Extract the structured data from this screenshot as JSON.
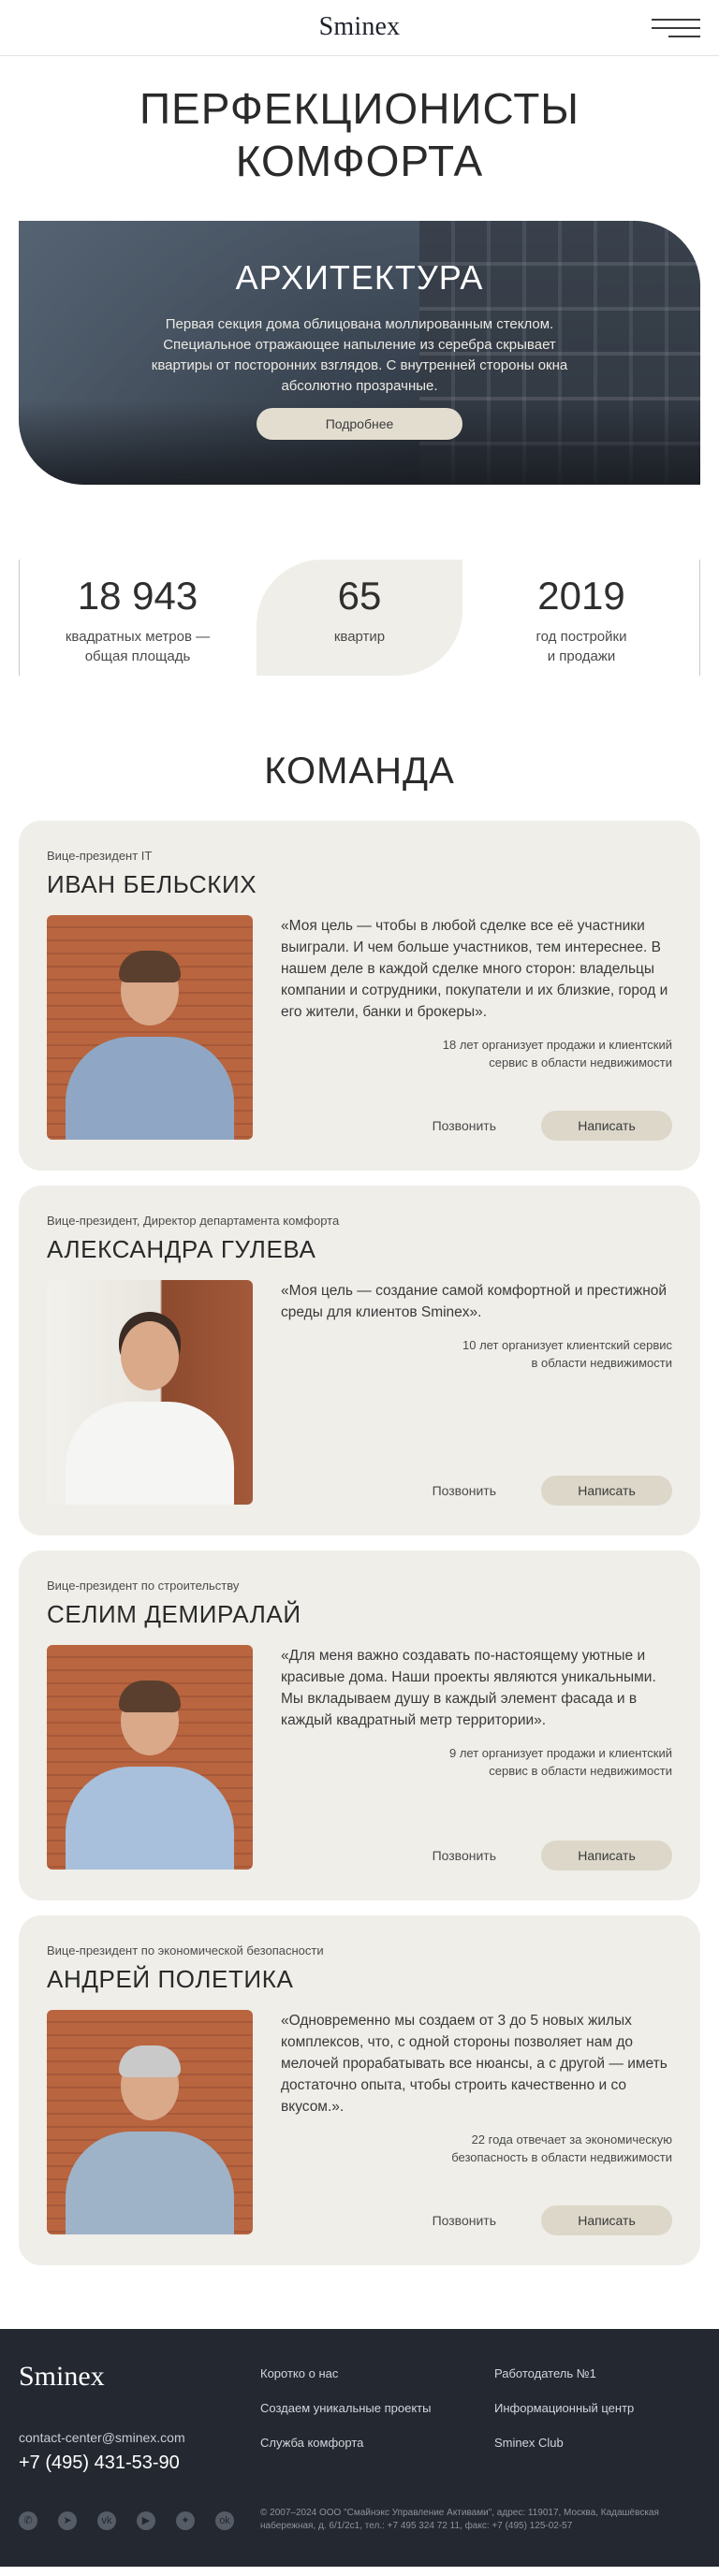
{
  "header": {
    "logo": "Sminex",
    "menu_icon": "burger-menu-icon"
  },
  "page_title_line1": "ПЕРФЕКЦИОНИСТЫ",
  "page_title_line2": "КОМФОРТА",
  "hero": {
    "title": "АРХИТЕКТУРА",
    "text": "Первая секция дома облицована моллированным стеклом. Специальное отражающее напыление из серебра скрывает квартиры от посторонних взглядов. С внутренней стороны окна абсолютно прозрачные.",
    "button": "Подробнее"
  },
  "stats": [
    {
      "num": "18 943",
      "label1": "квадратных метров —",
      "label2": "общая площадь"
    },
    {
      "num": "65",
      "label1": "квартир",
      "label2": ""
    },
    {
      "num": "2019",
      "label1": "год постройки",
      "label2": "и продажи"
    }
  ],
  "team_title": "КОМАНДА",
  "team": [
    {
      "role": "Вице-президент IT",
      "name": "ИВАН БЕЛЬСКИХ",
      "quote": "«Моя цель — чтобы в любой сделке все её участники выиграли. И чем больше участников, тем интереснее. В нашем деле в каждой сделке много сторон: владельцы компании и сотрудники, покупатели и их близкие, город и его жители, банки и брокеры».",
      "exp1": "18 лет организует продажи и клиентский",
      "exp2": "сервис в области недвижимости",
      "call": "Позвонить",
      "write": "Написать"
    },
    {
      "role": "Вице-президент, Директор департамента комфорта",
      "name": "АЛЕКСАНДРА ГУЛЕВА",
      "quote": "«Моя цель — создание самой комфортной и престижной среды для клиентов Sminex».",
      "exp1": "10 лет организует клиентский сервис",
      "exp2": "в области недвижимости",
      "call": "Позвонить",
      "write": "Написать"
    },
    {
      "role": "Вице-президент по строительству",
      "name": "СЕЛИМ ДЕМИРАЛАЙ",
      "quote": "«Для меня важно создавать по-настоящему уютные и красивые дома. Наши проекты являются уникальными. Мы вкладываем душу в каждый элемент фасада и в каждый квадратный метр территории».",
      "exp1": "9 лет организует продажи и клиентский",
      "exp2": "сервис в области недвижимости",
      "call": "Позвонить",
      "write": "Написать"
    },
    {
      "role": "Вице-президент по экономической безопасности",
      "name": "АНДРЕЙ ПОЛЕТИКА",
      "quote": "«Одновременно мы создаем от 3 до 5 новых жилых комплексов, что, с одной стороны позволяет нам до мелочей прорабатывать все нюансы, а с другой — иметь достаточно опыта, чтобы строить качественно и со вкусом.».",
      "exp1": "22 года отвечает за экономическую",
      "exp2": "безопасность в области недвижимости",
      "call": "Позвонить",
      "write": "Написать"
    }
  ],
  "footer": {
    "logo": "Sminex",
    "email": "contact-center@sminex.com",
    "phone": "+7 (495) 431-53-90",
    "col1": [
      "Коротко о нас",
      "Создаем уникальные проекты",
      "Служба комфорта"
    ],
    "col2": [
      "Работодатель №1",
      "Информационный центр",
      "Sminex Club"
    ],
    "legal": "© 2007–2024 ООО \"Смайнэкс Управление Активами\", адрес: 119017, Москва, Кадашёвская набережная, д. 6/1/2с1, тел.: +7 495 324 72 11, факс: +7 (495) 125-02-57",
    "socials": [
      "whatsapp-icon",
      "telegram-icon",
      "vk-icon",
      "youtube-icon",
      "dzen-icon",
      "ok-icon"
    ]
  }
}
